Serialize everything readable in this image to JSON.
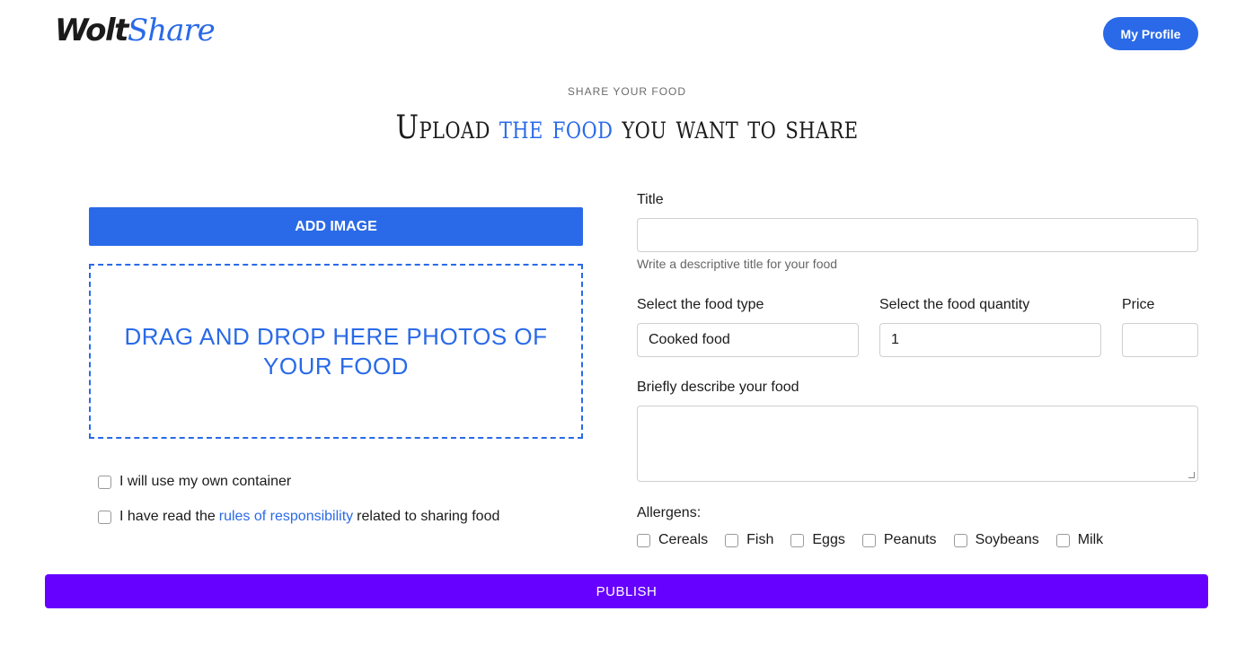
{
  "brand": {
    "part1": "Wolt",
    "part2": "Share"
  },
  "header": {
    "profile_button": "My Profile"
  },
  "hero": {
    "eyebrow": "SHARE YOUR FOOD",
    "title_before": "Upload ",
    "title_highlight": "the food",
    "title_after": " you want to share"
  },
  "upload": {
    "add_image_label": "ADD IMAGE",
    "dropzone_text": "DRAG AND DROP HERE PHOTOS OF YOUR FOOD"
  },
  "checks": {
    "own_container": "I will use my own container",
    "rules_before": "I have read the",
    "rules_link": "rules of responsibility",
    "rules_after": "related to sharing food"
  },
  "form": {
    "title_label": "Title",
    "title_value": "",
    "title_hint": "Write a descriptive title for your food",
    "food_type_label": "Select the food type",
    "food_type_value": "Cooked food",
    "quantity_label": "Select the food quantity",
    "quantity_value": "1",
    "price_label": "Price",
    "price_value": "",
    "description_label": "Briefly describe your food",
    "allergens_label": "Allergens:",
    "allergens": [
      "Cereals",
      "Fish",
      "Eggs",
      "Peanuts",
      "Soybeans",
      "Milk"
    ]
  },
  "publish_label": "PUBLISH",
  "colors": {
    "primary": "#2a6ae8",
    "publish": "#6600ff"
  }
}
